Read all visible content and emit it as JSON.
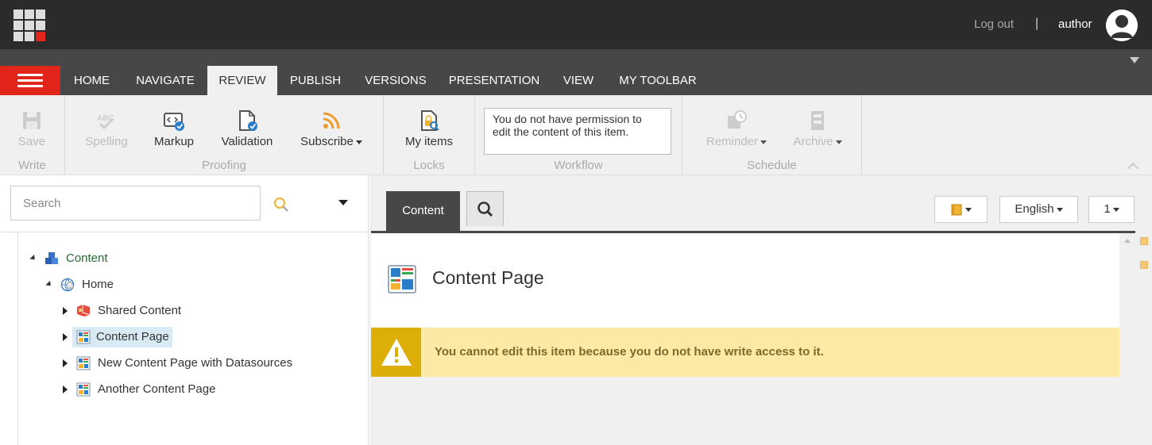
{
  "header": {
    "logout_label": "Log out",
    "separator": "|",
    "username": "author"
  },
  "tabs": [
    {
      "label": "HOME"
    },
    {
      "label": "NAVIGATE"
    },
    {
      "label": "REVIEW",
      "active": true
    },
    {
      "label": "PUBLISH"
    },
    {
      "label": "VERSIONS"
    },
    {
      "label": "PRESENTATION"
    },
    {
      "label": "VIEW"
    },
    {
      "label": "MY TOOLBAR"
    }
  ],
  "ribbon": {
    "write": {
      "label": "Write",
      "save": "Save"
    },
    "proofing": {
      "label": "Proofing",
      "spelling": "Spelling",
      "markup": "Markup",
      "validation": "Validation",
      "subscribe": "Subscribe"
    },
    "locks": {
      "label": "Locks",
      "my_items": "My items"
    },
    "workflow": {
      "label": "Workflow",
      "message": "You do not have permission to edit the content of this item."
    },
    "schedule": {
      "label": "Schedule",
      "reminder": "Reminder",
      "archive": "Archive"
    }
  },
  "search": {
    "placeholder": "Search"
  },
  "tree": {
    "root": "Content",
    "home": "Home",
    "children": [
      {
        "label": "Shared Content"
      },
      {
        "label": "Content Page",
        "selected": true
      },
      {
        "label": "New Content Page with Datasources"
      },
      {
        "label": "Another Content Page"
      }
    ]
  },
  "editor": {
    "tab_label": "Content",
    "language": "English",
    "version": "1",
    "item_title": "Content Page",
    "warning": "You cannot edit this item because you do not have write access to it."
  },
  "colors": {
    "brand_red": "#e1251b",
    "topbar": "#2b2b2b",
    "tabbar": "#474747",
    "warning_bg": "#fce9a4",
    "warning_icon_bg": "#ddae07"
  }
}
